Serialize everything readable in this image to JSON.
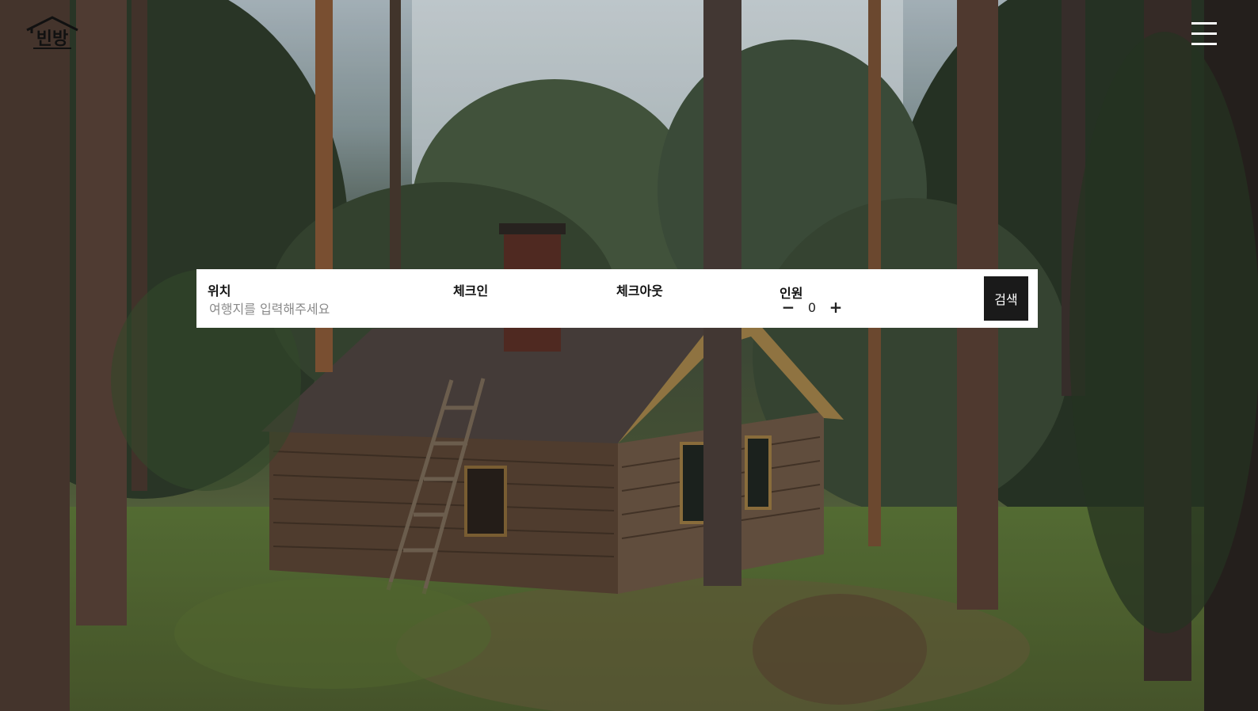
{
  "header": {
    "logo_text": "빈방",
    "logo_icon": "house-logo-icon",
    "menu_icon": "hamburger-menu-icon"
  },
  "search": {
    "location_label": "위치",
    "location_placeholder": "여행지를 입력해주세요",
    "checkin_label": "체크인",
    "checkout_label": "체크아웃",
    "guests_label": "인원",
    "guests_count": "0",
    "decrement_symbol": "−",
    "increment_symbol": "+",
    "search_button_label": "검색"
  },
  "colors": {
    "search_button_bg": "#1a1a1a",
    "search_bar_bg": "#ffffff",
    "menu_icon": "#ffffff"
  }
}
